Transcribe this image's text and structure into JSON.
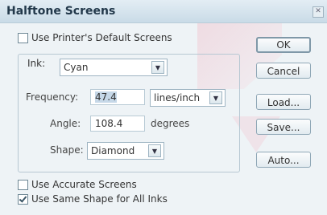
{
  "window": {
    "title": "Halftone Screens"
  },
  "options": {
    "use_printer_default": {
      "label": "Use Printer's Default Screens",
      "checked": false
    },
    "use_accurate": {
      "label": "Use Accurate Screens",
      "checked": false
    },
    "use_same_shape": {
      "label": "Use Same Shape for All Inks",
      "checked": true
    }
  },
  "ink": {
    "label": "Ink:",
    "value": "Cyan"
  },
  "frequency": {
    "label": "Frequency:",
    "value": "47.4",
    "unit": "lines/inch"
  },
  "angle": {
    "label": "Angle:",
    "value": "108.4",
    "unit": "degrees"
  },
  "shape": {
    "label": "Shape:",
    "value": "Diamond"
  },
  "buttons": {
    "ok": "OK",
    "cancel": "Cancel",
    "load": "Load...",
    "save": "Save...",
    "auto": "Auto..."
  },
  "icons": {
    "dropdown": "chevron-down-icon",
    "close": "close-icon",
    "check": "checkmark-icon"
  }
}
